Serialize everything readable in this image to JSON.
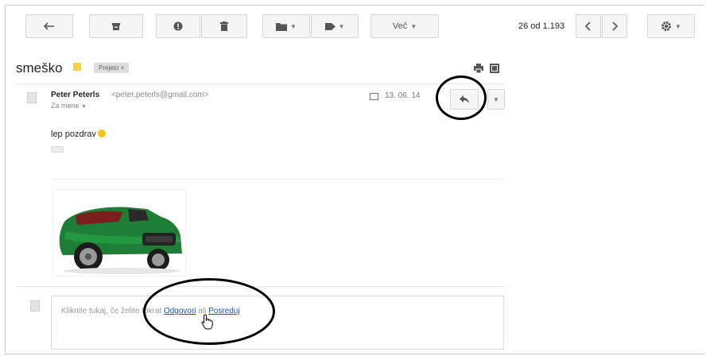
{
  "toolbar": {
    "more_label": "Več",
    "pagination": "26 od 1.193"
  },
  "message": {
    "subject": "smeško",
    "label": "Prejeto",
    "sender_name": "Peter Peterls",
    "sender_email": "<peter.peterls@gmail.com>",
    "to": "Za mene",
    "date": "13. 06. 14",
    "body": "lep pozdrav"
  },
  "reply": {
    "prefix": "Kliknite tukaj, če želite tokrat ",
    "reply_link": "Odgovori",
    "middle": " ali ",
    "forward_link": "Posreduj"
  },
  "colors": {
    "accent_link": "#1155cc",
    "car_green": "#1f8a3a",
    "label_yellow": "#f5d04a"
  },
  "icons": [
    "back-arrow-icon",
    "archive-icon",
    "spam-icon",
    "trash-icon",
    "folder-icon",
    "tag-icon",
    "chevron-left-icon",
    "chevron-right-icon",
    "gear-icon",
    "print-icon",
    "expand-icon",
    "reply-icon",
    "calendar-icon",
    "hand-cursor-icon"
  ]
}
